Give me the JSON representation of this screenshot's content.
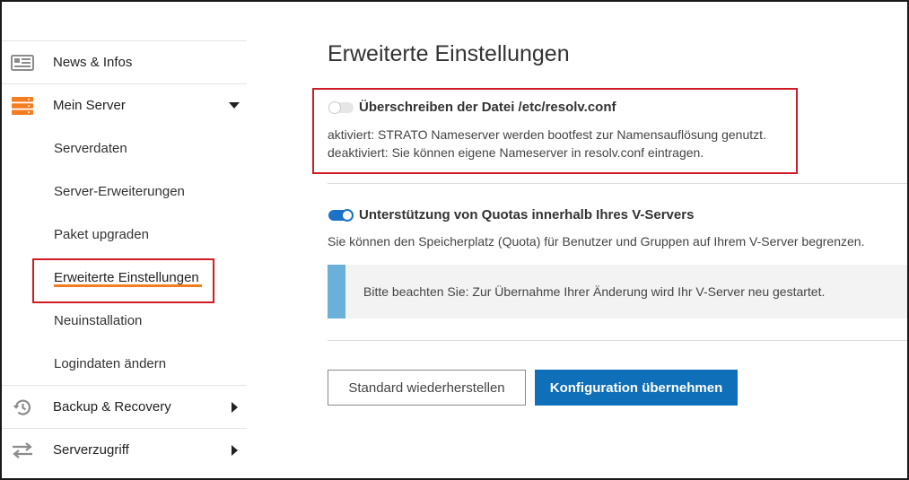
{
  "sidebar": {
    "items": [
      {
        "label": "News & Infos",
        "icon": "news-icon"
      },
      {
        "label": "Mein Server",
        "icon": "server-icon",
        "expanded": true
      },
      {
        "label": "Backup & Recovery",
        "icon": "history-icon"
      },
      {
        "label": "Serverzugriff",
        "icon": "transfer-icon"
      }
    ],
    "subitems": [
      {
        "label": "Serverdaten"
      },
      {
        "label": "Server-Erweiterungen"
      },
      {
        "label": "Paket upgraden"
      },
      {
        "label": "Erweiterte Einstellungen",
        "active": true
      },
      {
        "label": "Neuinstallation"
      },
      {
        "label": "Logindaten ändern"
      }
    ]
  },
  "main": {
    "title": "Erweiterte Einstellungen",
    "option1": {
      "title": "Überschreiben der Datei /etc/resolv.conf",
      "enabled": false,
      "line1": "aktiviert: STRATO Nameserver werden bootfest zur Namensauflösung genutzt.",
      "line2": "deaktiviert: Sie können eigene Nameserver in resolv.conf eintragen."
    },
    "option2": {
      "title": "Unterstützung von Quotas innerhalb Ihres V-Servers",
      "enabled": true,
      "description": "Sie können den Speicherplatz (Quota) für Benutzer und Gruppen auf Ihrem V-Server begrenzen."
    },
    "notice": "Bitte beachten Sie: Zur Übernahme Ihrer Änderung wird Ihr V-Server neu gestartet.",
    "buttons": {
      "reset": "Standard wiederherstellen",
      "apply": "Konfiguration übernehmen"
    }
  },
  "colors": {
    "accent": "#0f6fb8",
    "highlight": "#d01c24",
    "active_underline": "#f47d20",
    "server_icon": "#f47d20",
    "notice_bar": "#6ab0d8"
  }
}
